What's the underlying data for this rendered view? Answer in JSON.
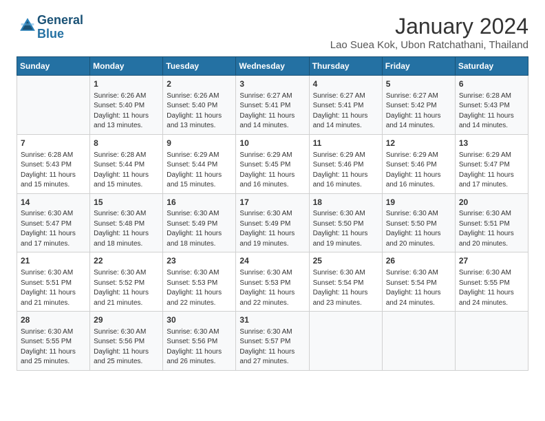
{
  "logo": {
    "text_general": "General",
    "text_blue": "Blue"
  },
  "title": "January 2024",
  "subtitle": "Lao Suea Kok, Ubon Ratchathani, Thailand",
  "days_of_week": [
    "Sunday",
    "Monday",
    "Tuesday",
    "Wednesday",
    "Thursday",
    "Friday",
    "Saturday"
  ],
  "weeks": [
    [
      {
        "day": "",
        "sunrise": "",
        "sunset": "",
        "daylight": ""
      },
      {
        "day": "1",
        "sunrise": "Sunrise: 6:26 AM",
        "sunset": "Sunset: 5:40 PM",
        "daylight": "Daylight: 11 hours and 13 minutes."
      },
      {
        "day": "2",
        "sunrise": "Sunrise: 6:26 AM",
        "sunset": "Sunset: 5:40 PM",
        "daylight": "Daylight: 11 hours and 13 minutes."
      },
      {
        "day": "3",
        "sunrise": "Sunrise: 6:27 AM",
        "sunset": "Sunset: 5:41 PM",
        "daylight": "Daylight: 11 hours and 14 minutes."
      },
      {
        "day": "4",
        "sunrise": "Sunrise: 6:27 AM",
        "sunset": "Sunset: 5:41 PM",
        "daylight": "Daylight: 11 hours and 14 minutes."
      },
      {
        "day": "5",
        "sunrise": "Sunrise: 6:27 AM",
        "sunset": "Sunset: 5:42 PM",
        "daylight": "Daylight: 11 hours and 14 minutes."
      },
      {
        "day": "6",
        "sunrise": "Sunrise: 6:28 AM",
        "sunset": "Sunset: 5:43 PM",
        "daylight": "Daylight: 11 hours and 14 minutes."
      }
    ],
    [
      {
        "day": "7",
        "sunrise": "Sunrise: 6:28 AM",
        "sunset": "Sunset: 5:43 PM",
        "daylight": "Daylight: 11 hours and 15 minutes."
      },
      {
        "day": "8",
        "sunrise": "Sunrise: 6:28 AM",
        "sunset": "Sunset: 5:44 PM",
        "daylight": "Daylight: 11 hours and 15 minutes."
      },
      {
        "day": "9",
        "sunrise": "Sunrise: 6:29 AM",
        "sunset": "Sunset: 5:44 PM",
        "daylight": "Daylight: 11 hours and 15 minutes."
      },
      {
        "day": "10",
        "sunrise": "Sunrise: 6:29 AM",
        "sunset": "Sunset: 5:45 PM",
        "daylight": "Daylight: 11 hours and 16 minutes."
      },
      {
        "day": "11",
        "sunrise": "Sunrise: 6:29 AM",
        "sunset": "Sunset: 5:46 PM",
        "daylight": "Daylight: 11 hours and 16 minutes."
      },
      {
        "day": "12",
        "sunrise": "Sunrise: 6:29 AM",
        "sunset": "Sunset: 5:46 PM",
        "daylight": "Daylight: 11 hours and 16 minutes."
      },
      {
        "day": "13",
        "sunrise": "Sunrise: 6:29 AM",
        "sunset": "Sunset: 5:47 PM",
        "daylight": "Daylight: 11 hours and 17 minutes."
      }
    ],
    [
      {
        "day": "14",
        "sunrise": "Sunrise: 6:30 AM",
        "sunset": "Sunset: 5:47 PM",
        "daylight": "Daylight: 11 hours and 17 minutes."
      },
      {
        "day": "15",
        "sunrise": "Sunrise: 6:30 AM",
        "sunset": "Sunset: 5:48 PM",
        "daylight": "Daylight: 11 hours and 18 minutes."
      },
      {
        "day": "16",
        "sunrise": "Sunrise: 6:30 AM",
        "sunset": "Sunset: 5:49 PM",
        "daylight": "Daylight: 11 hours and 18 minutes."
      },
      {
        "day": "17",
        "sunrise": "Sunrise: 6:30 AM",
        "sunset": "Sunset: 5:49 PM",
        "daylight": "Daylight: 11 hours and 19 minutes."
      },
      {
        "day": "18",
        "sunrise": "Sunrise: 6:30 AM",
        "sunset": "Sunset: 5:50 PM",
        "daylight": "Daylight: 11 hours and 19 minutes."
      },
      {
        "day": "19",
        "sunrise": "Sunrise: 6:30 AM",
        "sunset": "Sunset: 5:50 PM",
        "daylight": "Daylight: 11 hours and 20 minutes."
      },
      {
        "day": "20",
        "sunrise": "Sunrise: 6:30 AM",
        "sunset": "Sunset: 5:51 PM",
        "daylight": "Daylight: 11 hours and 20 minutes."
      }
    ],
    [
      {
        "day": "21",
        "sunrise": "Sunrise: 6:30 AM",
        "sunset": "Sunset: 5:51 PM",
        "daylight": "Daylight: 11 hours and 21 minutes."
      },
      {
        "day": "22",
        "sunrise": "Sunrise: 6:30 AM",
        "sunset": "Sunset: 5:52 PM",
        "daylight": "Daylight: 11 hours and 21 minutes."
      },
      {
        "day": "23",
        "sunrise": "Sunrise: 6:30 AM",
        "sunset": "Sunset: 5:53 PM",
        "daylight": "Daylight: 11 hours and 22 minutes."
      },
      {
        "day": "24",
        "sunrise": "Sunrise: 6:30 AM",
        "sunset": "Sunset: 5:53 PM",
        "daylight": "Daylight: 11 hours and 22 minutes."
      },
      {
        "day": "25",
        "sunrise": "Sunrise: 6:30 AM",
        "sunset": "Sunset: 5:54 PM",
        "daylight": "Daylight: 11 hours and 23 minutes."
      },
      {
        "day": "26",
        "sunrise": "Sunrise: 6:30 AM",
        "sunset": "Sunset: 5:54 PM",
        "daylight": "Daylight: 11 hours and 24 minutes."
      },
      {
        "day": "27",
        "sunrise": "Sunrise: 6:30 AM",
        "sunset": "Sunset: 5:55 PM",
        "daylight": "Daylight: 11 hours and 24 minutes."
      }
    ],
    [
      {
        "day": "28",
        "sunrise": "Sunrise: 6:30 AM",
        "sunset": "Sunset: 5:55 PM",
        "daylight": "Daylight: 11 hours and 25 minutes."
      },
      {
        "day": "29",
        "sunrise": "Sunrise: 6:30 AM",
        "sunset": "Sunset: 5:56 PM",
        "daylight": "Daylight: 11 hours and 25 minutes."
      },
      {
        "day": "30",
        "sunrise": "Sunrise: 6:30 AM",
        "sunset": "Sunset: 5:56 PM",
        "daylight": "Daylight: 11 hours and 26 minutes."
      },
      {
        "day": "31",
        "sunrise": "Sunrise: 6:30 AM",
        "sunset": "Sunset: 5:57 PM",
        "daylight": "Daylight: 11 hours and 27 minutes."
      },
      {
        "day": "",
        "sunrise": "",
        "sunset": "",
        "daylight": ""
      },
      {
        "day": "",
        "sunrise": "",
        "sunset": "",
        "daylight": ""
      },
      {
        "day": "",
        "sunrise": "",
        "sunset": "",
        "daylight": ""
      }
    ]
  ]
}
